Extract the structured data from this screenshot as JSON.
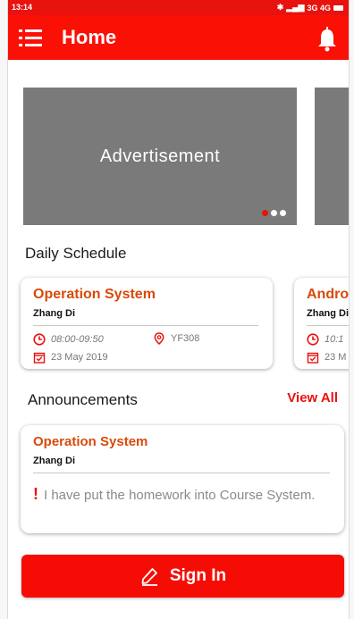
{
  "status_bar": {
    "time": "13:14",
    "signal_text": "3G 4G"
  },
  "app_bar": {
    "title": "Home"
  },
  "carousel": {
    "items": [
      {
        "label": "Advertisement"
      },
      {
        "label": ""
      }
    ],
    "active_index": 0,
    "page_count": 3
  },
  "schedule": {
    "title": "Daily Schedule",
    "items": [
      {
        "course": "Operation System",
        "teacher": "Zhang Di",
        "time": "08:00-09:50",
        "room": "YF308",
        "date": "23 May 2019"
      },
      {
        "course": "Androi",
        "teacher": "Zhang Di",
        "time": "10:1",
        "date": "23 M"
      }
    ]
  },
  "announcements": {
    "title": "Announcements",
    "view_all": "View All",
    "items": [
      {
        "course": "Operation System",
        "teacher": "Zhang Di",
        "message": "I have put the homework into Course System."
      }
    ]
  },
  "sign_in": {
    "label": "Sign In"
  },
  "colors": {
    "primary": "#fb1006",
    "course_orange": "#d94a0a",
    "grey_banner": "#7a7a7a"
  }
}
